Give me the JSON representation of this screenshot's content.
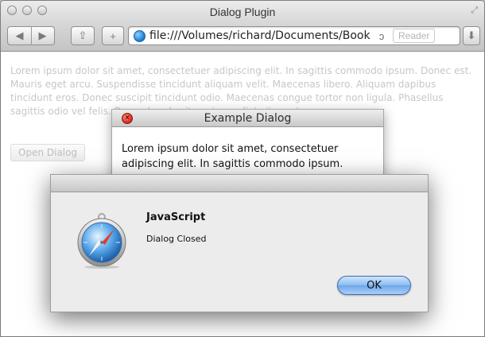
{
  "window": {
    "title": "Dialog Plugin"
  },
  "toolbar": {
    "back_label": "◀",
    "forward_label": "▶",
    "share_label": "⇪",
    "add_label": "+",
    "url": "file:///Volumes/richard/Documents/Book",
    "reload_label": "ↄ",
    "reader_label": "Reader",
    "downloads_label": "⬇"
  },
  "page": {
    "lorem": "Lorem ipsum dolor sit amet, consectetuer adipiscing elit. In sagittis commodo ipsum. Donec est. Mauris eget arcu. Suspendisse tincidunt aliquam velit. Maecenas libero. Aliquam dapibus tincidunt eros. Donec suscipit tincidunt odio. Maecenas congue tortor non ligula. Phasellus sagittis odio vel felis. Donec hendrerit ac, imperdiet sit amet,",
    "open_button": "Open Dialog"
  },
  "example_dialog": {
    "title": "Example Dialog",
    "close_glyph": "×",
    "body": "Lorem ipsum dolor sit amet, consectetuer adipiscing elit. In sagittis commodo ipsum."
  },
  "alert": {
    "heading": "JavaScript",
    "message": "Dialog Closed",
    "ok_label": "OK",
    "icon": "safari-compass-icon"
  }
}
